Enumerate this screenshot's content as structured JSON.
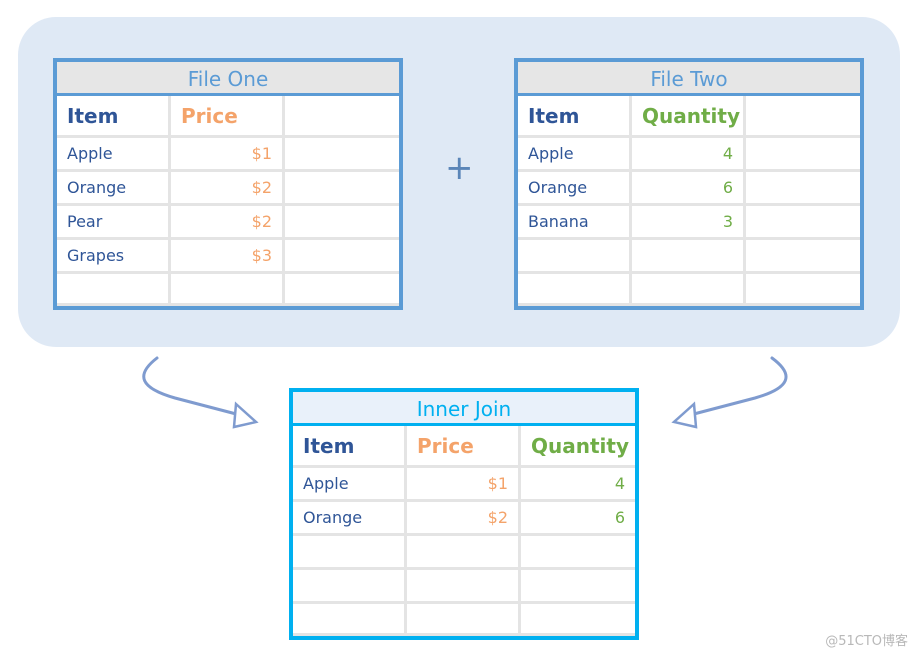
{
  "colors": {
    "panel": "#dfe9f5",
    "file_border": "#5b9bd5",
    "join_border": "#00b0f0",
    "item": "#2f5597",
    "price": "#f4a36a",
    "quantity": "#70ad47",
    "arrow": "#7f9bcf"
  },
  "operator": "+",
  "tables": {
    "file_one": {
      "title": "File One",
      "headers": [
        "Item",
        "Price",
        ""
      ],
      "rows": [
        [
          "Apple",
          "$1",
          ""
        ],
        [
          "Orange",
          "$2",
          ""
        ],
        [
          "Pear",
          "$2",
          ""
        ],
        [
          "Grapes",
          "$3",
          ""
        ],
        [
          "",
          "",
          ""
        ]
      ]
    },
    "file_two": {
      "title": "File Two",
      "headers": [
        "Item",
        "Quantity",
        ""
      ],
      "rows": [
        [
          "Apple",
          "4",
          ""
        ],
        [
          "Orange",
          "6",
          ""
        ],
        [
          "Banana",
          "3",
          ""
        ],
        [
          "",
          "",
          ""
        ],
        [
          "",
          "",
          ""
        ]
      ]
    },
    "inner_join": {
      "title": "Inner Join",
      "headers": [
        "Item",
        "Price",
        "Quantity"
      ],
      "rows": [
        [
          "Apple",
          "$1",
          "4"
        ],
        [
          "Orange",
          "$2",
          "6"
        ],
        [
          "",
          "",
          ""
        ],
        [
          "",
          "",
          ""
        ],
        [
          "",
          "",
          ""
        ]
      ]
    }
  },
  "watermark": "@51CTO博客"
}
